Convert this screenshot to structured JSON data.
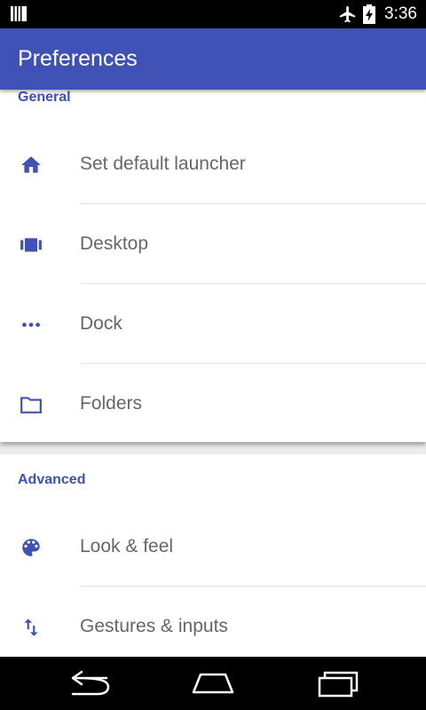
{
  "status_bar": {
    "time": "3:36",
    "icons": [
      "notification-icon",
      "airplane-mode-icon",
      "battery-charging-icon"
    ]
  },
  "app_bar": {
    "title": "Preferences",
    "color": "#3f51b5"
  },
  "sections": {
    "general": {
      "header": "General",
      "items": [
        {
          "label": "Set default launcher",
          "icon": "home-icon"
        },
        {
          "label": "Desktop",
          "icon": "desktop-icon"
        },
        {
          "label": "Dock",
          "icon": "more-horiz-icon"
        },
        {
          "label": "Folders",
          "icon": "folder-icon"
        }
      ]
    },
    "advanced": {
      "header": "Advanced",
      "items": [
        {
          "label": "Look & feel",
          "icon": "palette-icon"
        },
        {
          "label": "Gestures & inputs",
          "icon": "swap-vert-icon"
        }
      ]
    }
  },
  "nav_bar": {
    "buttons": [
      "back-icon",
      "home-nav-icon",
      "recents-icon"
    ]
  }
}
